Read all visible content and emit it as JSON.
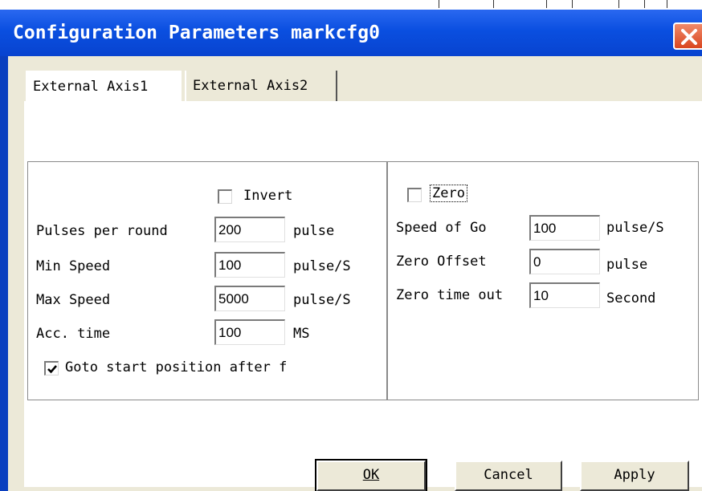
{
  "window": {
    "title": "Configuration Parameters markcfg0"
  },
  "tabs": [
    {
      "label": "External Axis1"
    },
    {
      "label": "External Axis2"
    }
  ],
  "left_group": {
    "invert_label": "Invert",
    "invert_checked": false,
    "fields": [
      {
        "label": "Pulses per round",
        "value": "200",
        "unit": "pulse"
      },
      {
        "label": "Min Speed",
        "value": "100",
        "unit": "pulse/S"
      },
      {
        "label": "Max Speed",
        "value": "5000",
        "unit": "pulse/S"
      },
      {
        "label": "Acc. time",
        "value": "100",
        "unit": "MS"
      }
    ],
    "goto_label": "Goto start position after f",
    "goto_checked": true
  },
  "right_group": {
    "zero_label": "Zero",
    "zero_checked": false,
    "fields": [
      {
        "label": "Speed of Go",
        "value": "100",
        "unit": "pulse/S"
      },
      {
        "label": "Zero Offset",
        "value": "0",
        "unit": "pulse"
      },
      {
        "label": "Zero time out",
        "value": "10",
        "unit": "Second"
      }
    ]
  },
  "buttons": {
    "ok": "OK",
    "cancel": "Cancel",
    "apply": "Apply"
  },
  "colors": {
    "title_bar": "#0a4fe0",
    "close": "#d9461f",
    "dialog_face": "#ece9d8"
  },
  "icons": {
    "close": "close-icon",
    "check": "check-icon"
  }
}
